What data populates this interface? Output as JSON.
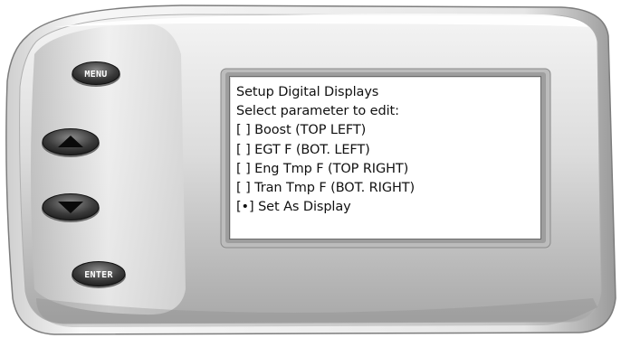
{
  "device": {
    "buttons": {
      "menu_label": "MENU",
      "up_icon": "arrow-up-icon",
      "down_icon": "arrow-down-icon",
      "enter_label": "ENTER"
    }
  },
  "screen": {
    "lines": [
      "Setup Digital Displays",
      "Select parameter to edit:",
      "[ ] Boost (TOP LEFT)",
      "[ ] EGT F (BOT. LEFT)",
      "[ ] Eng Tmp F (TOP RIGHT)",
      "[ ] Tran Tmp F (BOT. RIGHT)",
      "[•] Set As Display"
    ]
  }
}
